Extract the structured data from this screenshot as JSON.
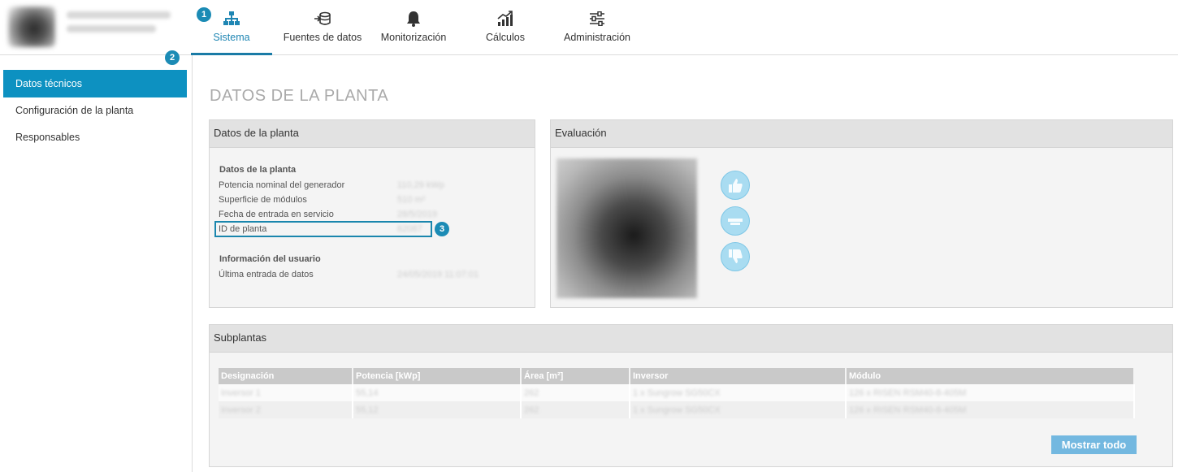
{
  "nav": {
    "items": [
      {
        "label": "Sistema",
        "icon": "sitemap-icon",
        "active": true
      },
      {
        "label": "Fuentes de datos",
        "icon": "database-import-icon"
      },
      {
        "label": "Monitorización",
        "icon": "bell-icon"
      },
      {
        "label": "Cálculos",
        "icon": "chart-trend-icon"
      },
      {
        "label": "Administración",
        "icon": "sliders-icon"
      }
    ]
  },
  "badges": {
    "b1": "1",
    "b2": "2",
    "b3": "3"
  },
  "sidebar": {
    "items": [
      {
        "label": "Datos técnicos",
        "active": true
      },
      {
        "label": "Configuración de la planta"
      },
      {
        "label": "Responsables"
      }
    ]
  },
  "page": {
    "title": "DATOS DE LA PLANTA"
  },
  "plant_panel": {
    "title": "Datos de la planta",
    "section1": "Datos de la planta",
    "rows": [
      {
        "label": "Potencia nominal del generador",
        "value": "110,29 kWp"
      },
      {
        "label": "Superficie de módulos",
        "value": "510 m²"
      },
      {
        "label": "Fecha de entrada en servicio",
        "value": "28/5/2019"
      },
      {
        "label": "ID de planta",
        "value": "62087"
      }
    ],
    "section2": "Información del usuario",
    "rows2": [
      {
        "label": "Última entrada de datos",
        "value": "24/05/2019 11:07:01"
      }
    ]
  },
  "eval_panel": {
    "title": "Evaluación"
  },
  "sub_panel": {
    "title": "Subplantas",
    "columns": [
      "Designación",
      "Potencia [kWp]",
      "Área [m²]",
      "Inversor",
      "Módulo"
    ],
    "rows": [
      [
        "Inversor 1",
        "55,14",
        "262",
        "1 x Sungrow SG50CX",
        "126 x RISEN RSM40-8-405M"
      ],
      [
        "Inversor 2",
        "55,12",
        "262",
        "1 x Sungrow SG50CX",
        "126 x RISEN RSM40-8-405M"
      ]
    ],
    "button": "Mostrar todo"
  },
  "colors": {
    "accent": "#0d91c1",
    "button": "#73b8e0",
    "thumb": "#a9dcf1"
  }
}
